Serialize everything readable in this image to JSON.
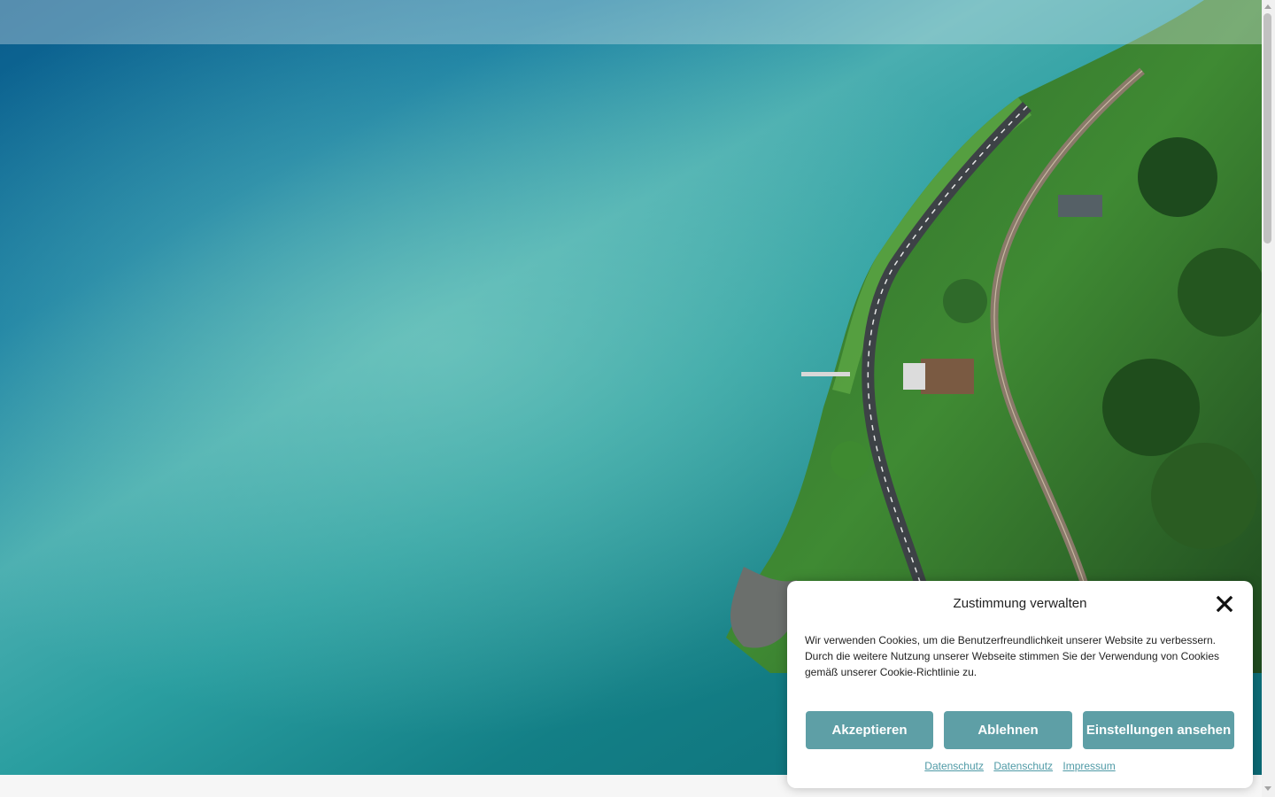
{
  "hero": {
    "image_alt": "aerial view of a turquoise lake with a forested shoreline, road and railway"
  },
  "cookie_banner": {
    "title": "Zustimmung verwalten",
    "message": "Wir verwenden Cookies, um die Benutzerfreundlichkeit unserer Website zu verbessern. Durch die weitere Nutzung unserer Webseite stimmen Sie der Verwendung von Cookies gemäß unserer Cookie-Richtlinie zu.",
    "close_icon": "close-icon",
    "buttons": {
      "accept": "Akzeptieren",
      "deny": "Ablehnen",
      "preferences": "Einstellungen ansehen"
    },
    "links": [
      "Datenschutz",
      "Datenschutz",
      "Impressum"
    ],
    "accent_color": "#5e9fa6"
  }
}
